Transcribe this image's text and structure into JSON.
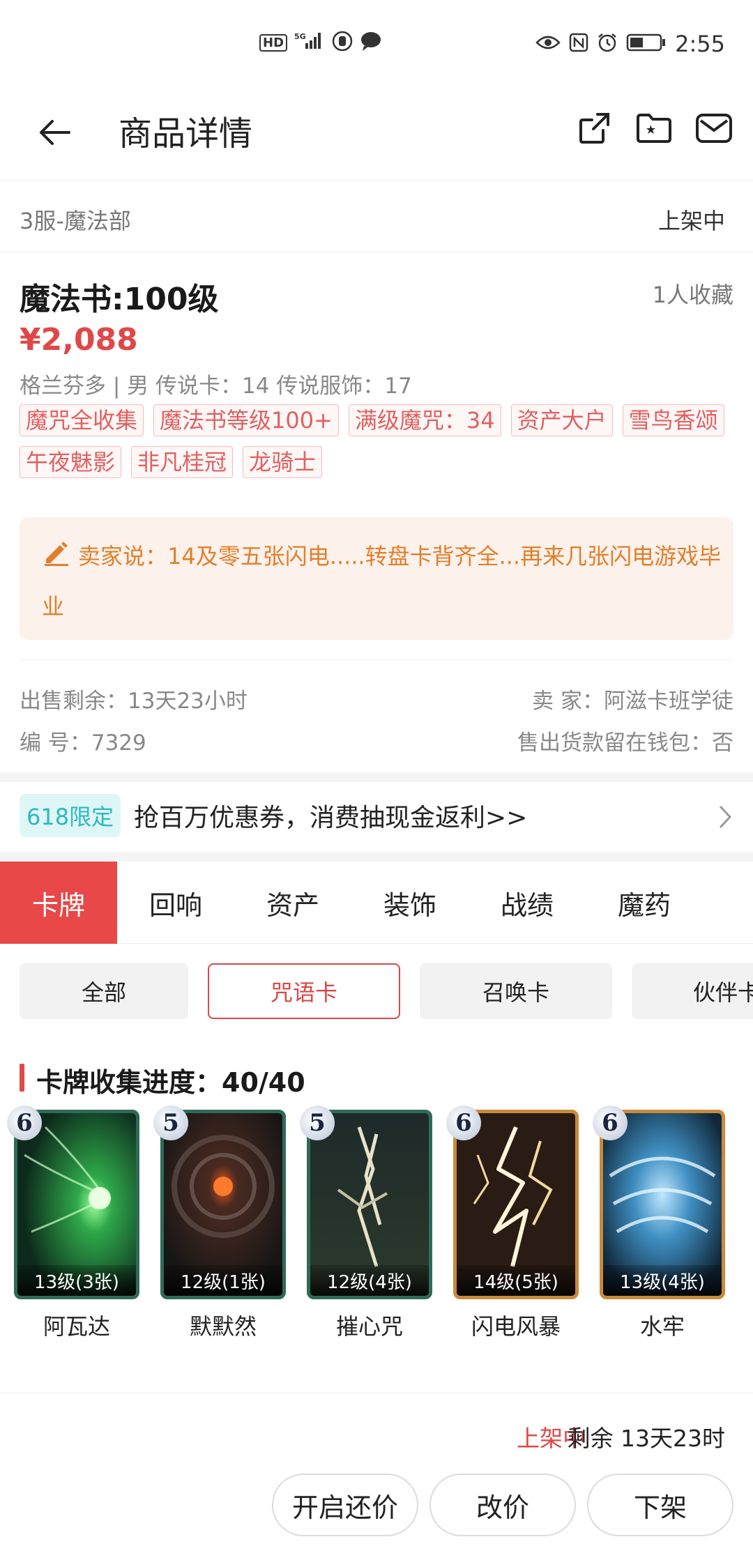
{
  "status_bar": {
    "network": "HD",
    "signal": "5G",
    "time": "2:55"
  },
  "header": {
    "title": "商品详情"
  },
  "listing": {
    "server": "3服-魔法部",
    "status": "上架中",
    "title": "魔法书:100级",
    "favorites": "1人收藏",
    "price": "¥2,088",
    "attributes": "格兰芬多 | 男  传说卡：14  传说服饰：17",
    "tags": [
      "魔咒全收集",
      "魔法书等级100+",
      "满级魔咒：34",
      "资产大户",
      "雪鸟香颂",
      "午夜魅影",
      "非凡桂冠",
      "龙骑士"
    ],
    "seller_says": "卖家说：14及零五张闪电.....转盘卡背齐全...再来几张闪电游戏毕业",
    "time_left": "出售剩余：13天23小时",
    "seller": "卖    家：阿滋卡班学徒",
    "serial": "编    号：7329",
    "wallet": "售出货款留在钱包：否"
  },
  "promo": {
    "badge": "618限定",
    "text": "抢百万优惠券，消费抽现金返利>>"
  },
  "tabs": [
    "卡牌",
    "回响",
    "资产",
    "装饰",
    "战绩",
    "魔药"
  ],
  "filters": [
    "全部",
    "咒语卡",
    "召唤卡",
    "伙伴卡"
  ],
  "collection": {
    "title": "卡牌收集进度：40/40"
  },
  "cards": [
    {
      "name": "阿瓦达",
      "tier": "6",
      "count": "13级(3张)",
      "frame": "green"
    },
    {
      "name": "默默然",
      "tier": "5",
      "count": "12级(1张)",
      "frame": "green"
    },
    {
      "name": "摧心咒",
      "tier": "5",
      "count": "12级(4张)",
      "frame": "green"
    },
    {
      "name": "闪电风暴",
      "tier": "6",
      "count": "14级(5张)",
      "frame": "gold"
    },
    {
      "name": "水牢",
      "tier": "6",
      "count": "13级(4张)",
      "frame": "gold"
    }
  ],
  "bottom": {
    "status": "上架中",
    "remaining": "剩余 13天23时",
    "buttons": [
      "开启还价",
      "改价",
      "下架"
    ]
  },
  "colors": {
    "accent_red": "#e84848",
    "seller_orange": "#e0802a",
    "promo_teal": "#2cb8c0"
  }
}
